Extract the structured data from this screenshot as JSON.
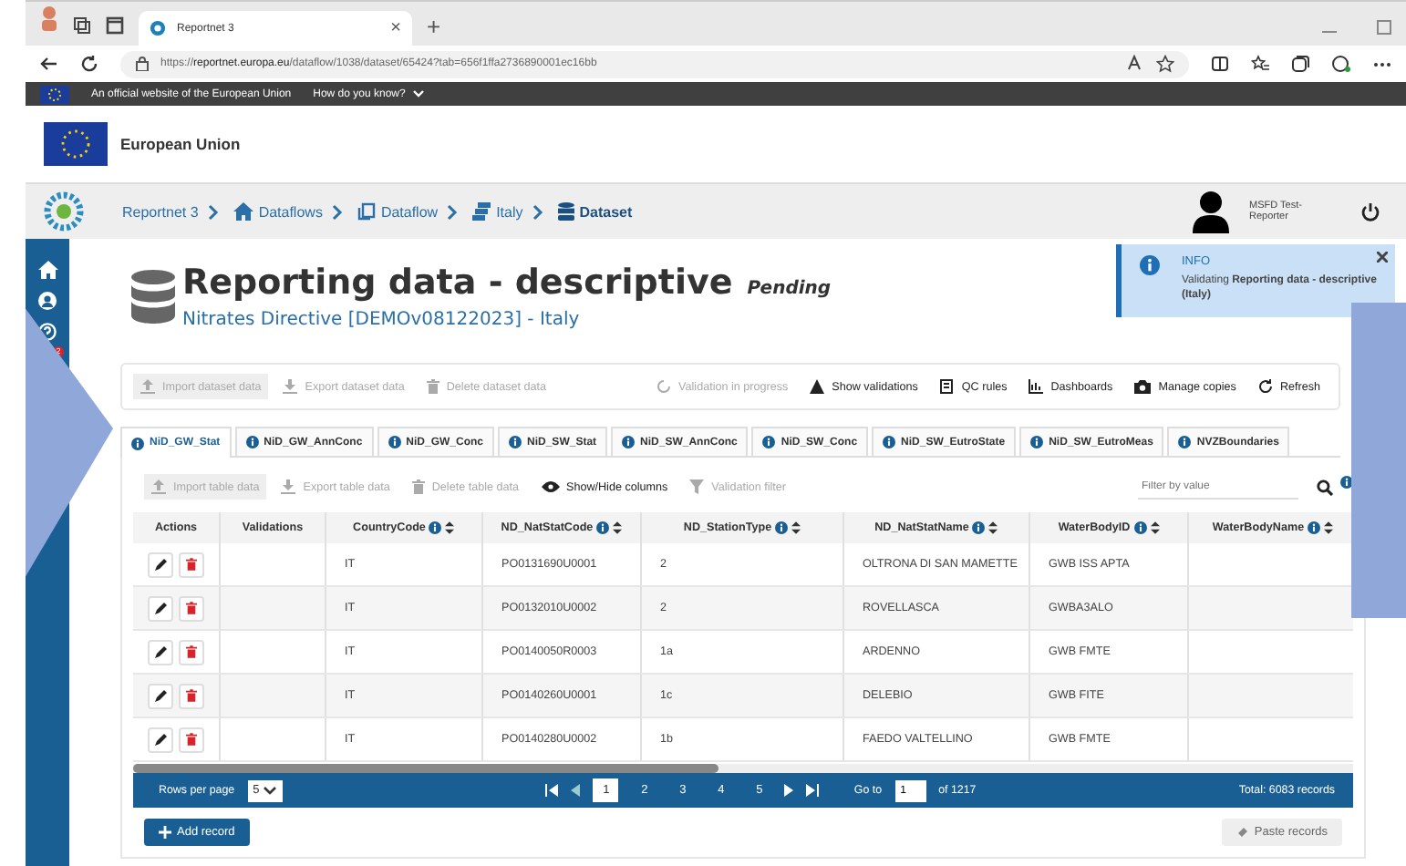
{
  "browser": {
    "tab_title": "Reportnet 3",
    "new_tab": "+",
    "close_tab": "×",
    "url_prefix": "https://",
    "url_host": "reportnet.europa.eu",
    "url_path": "/dataflow/1038/dataset/65424?tab=656f1ffa2736890001ec16bb"
  },
  "eu_banner": {
    "text": "An official website of the European Union",
    "link": "How do you know?"
  },
  "eu_header": {
    "name": "European Union"
  },
  "breadcrumb": [
    {
      "label": "Reportnet 3",
      "current": false
    },
    {
      "label": "Dataflows",
      "current": false
    },
    {
      "label": "Dataflow",
      "current": false
    },
    {
      "label": "Italy",
      "current": false
    },
    {
      "label": "Dataset",
      "current": true
    }
  ],
  "user": {
    "name": "MSFD Test-Reporter"
  },
  "sidebar": {
    "badge": "2"
  },
  "notification": {
    "title": "INFO",
    "message": "Validating **Reporting data - descriptive (Italy)**"
  },
  "header": {
    "title": "Reporting data - descriptive",
    "status": "Pending",
    "subtitle": "Nitrates Directive [DEMOv08122023] - Italy"
  },
  "dataset_toolbar_left": [
    {
      "label": "Import dataset data",
      "disabled": true
    },
    {
      "label": "Export dataset data",
      "disabled": true
    },
    {
      "label": "Delete dataset data",
      "disabled": true
    }
  ],
  "dataset_toolbar_right": [
    {
      "label": "Validation in progress",
      "disabled": true
    },
    {
      "label": "Show validations",
      "disabled": false
    },
    {
      "label": "QC rules",
      "disabled": false
    },
    {
      "label": "Dashboards",
      "disabled": false
    },
    {
      "label": "Manage copies",
      "disabled": false
    },
    {
      "label": "Refresh",
      "disabled": false
    }
  ],
  "tabs": [
    {
      "label": "NiD_GW_Stat",
      "selected": true
    },
    {
      "label": "NiD_GW_AnnConc",
      "selected": false
    },
    {
      "label": "NiD_GW_Conc",
      "selected": false
    },
    {
      "label": "NiD_SW_Stat",
      "selected": false
    },
    {
      "label": "NiD_SW_AnnConc",
      "selected": false
    },
    {
      "label": "NiD_SW_Conc",
      "selected": false
    },
    {
      "label": "NiD_SW_EutroState",
      "selected": false
    },
    {
      "label": "NiD_SW_EutroMeas",
      "selected": false
    },
    {
      "label": "NVZBoundaries",
      "selected": false
    }
  ],
  "table_toolbar": [
    {
      "label": "Import table data",
      "disabled": true
    },
    {
      "label": "Export table data",
      "disabled": true
    },
    {
      "label": "Delete table data",
      "disabled": true
    },
    {
      "label": "Show/Hide columns",
      "disabled": false
    },
    {
      "label": "Validation filter",
      "disabled": true
    }
  ],
  "filter": {
    "placeholder": "Filter by value"
  },
  "table": {
    "columns": [
      {
        "label": "Actions",
        "sortable": false
      },
      {
        "label": "Validations",
        "sortable": false
      },
      {
        "label": "CountryCode",
        "sortable": true
      },
      {
        "label": "ND_NatStatCode",
        "sortable": true
      },
      {
        "label": "ND_StationType",
        "sortable": true
      },
      {
        "label": "ND_NatStatName",
        "sortable": true
      },
      {
        "label": "WaterBodyID",
        "sortable": true
      },
      {
        "label": "WaterBodyName",
        "sortable": true
      }
    ],
    "rows": [
      {
        "cells": [
          "",
          "",
          "IT",
          "PO0131690U0001",
          "2",
          "OLTRONA DI SAN MAMETTE",
          "GWB ISS APTA",
          ""
        ]
      },
      {
        "cells": [
          "",
          "",
          "IT",
          "PO0132010U0002",
          "2",
          "ROVELLASCA",
          "GWBA3ALO",
          ""
        ]
      },
      {
        "cells": [
          "",
          "",
          "IT",
          "PO0140050R0003",
          "1a",
          "ARDENNO",
          "GWB FMTE",
          ""
        ]
      },
      {
        "cells": [
          "",
          "",
          "IT",
          "PO0140260U0001",
          "1c",
          "DELEBIO",
          "GWB FITE",
          ""
        ]
      },
      {
        "cells": [
          "",
          "",
          "IT",
          "PO0140280U0002",
          "1b",
          "FAEDO VALTELLINO",
          "GWB FMTE",
          ""
        ]
      }
    ]
  },
  "pagination": {
    "rows_label": "Rows per page",
    "rows_value": "5",
    "pages": [
      {
        "label": "1",
        "selected": true
      },
      {
        "label": "2",
        "selected": false
      },
      {
        "label": "3",
        "selected": false
      },
      {
        "label": "4",
        "selected": false
      },
      {
        "label": "5",
        "selected": false
      }
    ],
    "goto_label": "Go to",
    "goto_value": "1",
    "of_label": "of 1217",
    "total": "Total: 6083 records"
  },
  "footer_buttons": {
    "add": "Add record",
    "paste": "Paste records"
  }
}
